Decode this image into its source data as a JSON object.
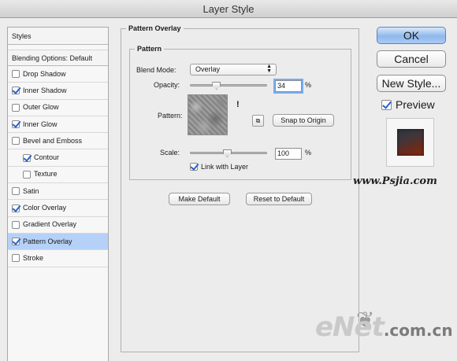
{
  "window": {
    "title": "Layer Style"
  },
  "sidebar": {
    "header": "Styles",
    "blending": "Blending Options: Default",
    "items": [
      {
        "label": "Drop Shadow",
        "checked": false,
        "sub": false,
        "selected": false
      },
      {
        "label": "Inner Shadow",
        "checked": true,
        "sub": false,
        "selected": false
      },
      {
        "label": "Outer Glow",
        "checked": false,
        "sub": false,
        "selected": false
      },
      {
        "label": "Inner Glow",
        "checked": true,
        "sub": false,
        "selected": false
      },
      {
        "label": "Bevel and Emboss",
        "checked": false,
        "sub": false,
        "selected": false
      },
      {
        "label": "Contour",
        "checked": true,
        "sub": true,
        "selected": false
      },
      {
        "label": "Texture",
        "checked": false,
        "sub": true,
        "selected": false
      },
      {
        "label": "Satin",
        "checked": false,
        "sub": false,
        "selected": false
      },
      {
        "label": "Color Overlay",
        "checked": true,
        "sub": false,
        "selected": false
      },
      {
        "label": "Gradient Overlay",
        "checked": false,
        "sub": false,
        "selected": false
      },
      {
        "label": "Pattern Overlay",
        "checked": true,
        "sub": false,
        "selected": true
      },
      {
        "label": "Stroke",
        "checked": false,
        "sub": false,
        "selected": false
      }
    ]
  },
  "panel": {
    "title": "Pattern Overlay",
    "group_title": "Pattern",
    "blend_mode_label": "Blend Mode:",
    "blend_mode_value": "Overlay",
    "opacity_label": "Opacity:",
    "opacity_value": "34",
    "opacity_level": 0.34,
    "opacity_unit": "%",
    "pattern_label": "Pattern:",
    "snap_button": "Snap to Origin",
    "scale_label": "Scale:",
    "scale_value": "100",
    "scale_unit": "%",
    "link_label": "Link with Layer",
    "link_checked": true,
    "make_default": "Make Default",
    "reset_default": "Reset to Default"
  },
  "actions": {
    "ok": "OK",
    "cancel": "Cancel",
    "new_style": "New Style...",
    "preview_label": "Preview",
    "preview_checked": true
  },
  "watermarks": {
    "site": "www.Psjia.com",
    "brand": "eNet",
    "brand_domain": ".com.cn"
  },
  "colors": {
    "selection": "#b5d1f7",
    "ok_button": "#8fb8ec",
    "preview_top": "#2c3440",
    "preview_bottom": "#872b10"
  }
}
